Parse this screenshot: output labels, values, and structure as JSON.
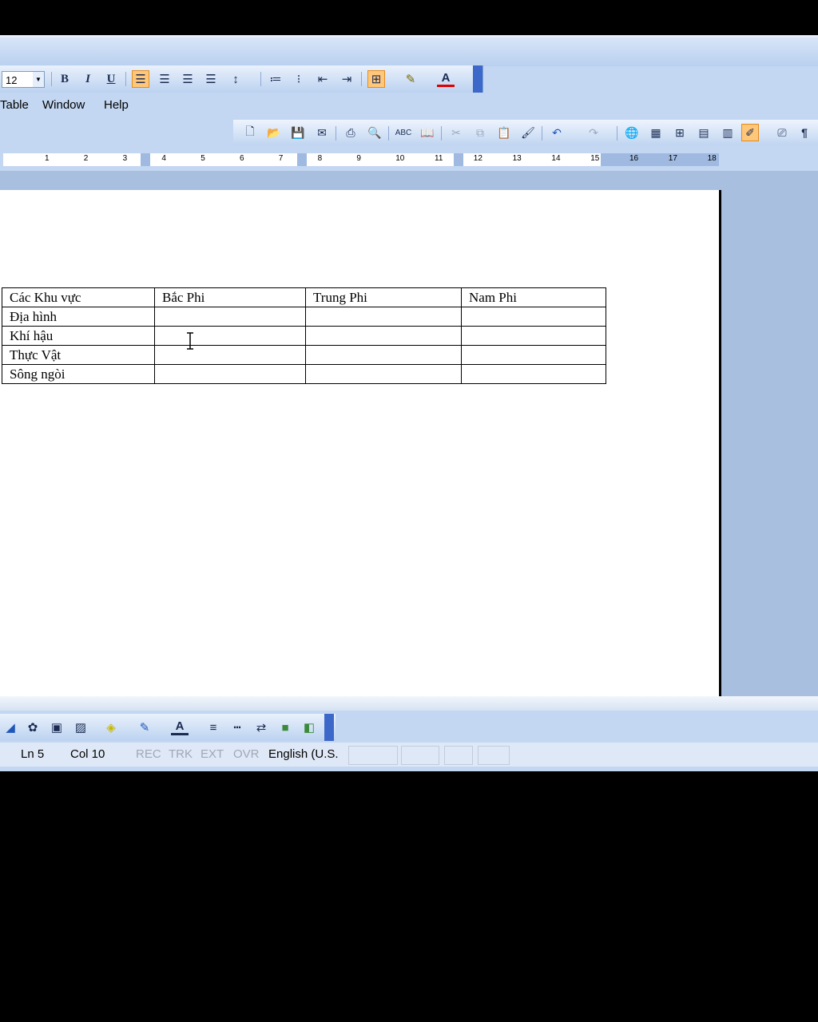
{
  "format_bar": {
    "font_size": "12",
    "bold": "B",
    "italic": "I",
    "underline": "U",
    "font_color_glyph": "A"
  },
  "menu": [
    "Table",
    "Window",
    "Help"
  ],
  "standard_bar": {
    "pilcrow": "¶"
  },
  "ruler": {
    "numbers": [
      "1",
      "2",
      "3",
      "4",
      "5",
      "6",
      "7",
      "8",
      "9",
      "10",
      "11",
      "12",
      "13",
      "14",
      "15",
      "16",
      "17",
      "18"
    ]
  },
  "table": {
    "header": [
      "Các Khu vực",
      "Bắc Phi",
      "Trung Phi",
      "Nam Phi"
    ],
    "rows": [
      [
        "Địa hình",
        "",
        "",
        ""
      ],
      [
        "Khí hậu",
        "",
        "",
        ""
      ],
      [
        "Thực Vật",
        "",
        "",
        ""
      ],
      [
        "Sông ngòi",
        "",
        "",
        ""
      ]
    ]
  },
  "status": {
    "ln": "Ln 5",
    "col": "Col 10",
    "rec": "REC",
    "trk": "TRK",
    "ext": "EXT",
    "ovr": "OVR",
    "language": "English (U.S."
  },
  "colors": {
    "accent": "#ffc77a",
    "toolbar": "#bcd2f0",
    "grip": "#3b68c9"
  }
}
